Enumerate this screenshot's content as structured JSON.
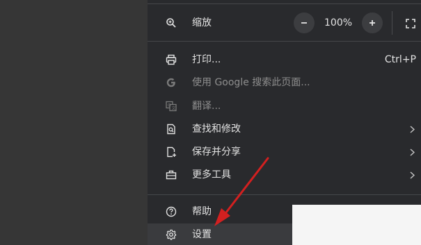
{
  "zoom": {
    "label": "缩放",
    "value": "100%",
    "minus": "−",
    "plus": "+"
  },
  "menu": {
    "print": {
      "label": "打印...",
      "shortcut": "Ctrl+P"
    },
    "google_search": {
      "label": "使用 Google 搜索此页面..."
    },
    "translate": {
      "label": "翻译..."
    },
    "find_edit": {
      "label": "查找和修改"
    },
    "save_share": {
      "label": "保存并分享"
    },
    "more_tools": {
      "label": "更多工具"
    },
    "help": {
      "label": "帮助"
    },
    "settings": {
      "label": "设置"
    }
  },
  "icons": {
    "zoom": "zoom-icon",
    "print": "printer-icon",
    "google": "google-g-icon",
    "translate": "translate-icon",
    "find": "find-icon",
    "save": "save-share-icon",
    "tools": "toolbox-icon",
    "help": "help-icon",
    "settings": "gear-icon",
    "chevron": "chevron-right-icon",
    "fullscreen": "fullscreen-icon"
  },
  "colors": {
    "menu_bg": "#292a2d",
    "text": "#e3e3e3",
    "disabled_text": "#8e8e8e",
    "annotation_arrow": "#d32020"
  }
}
